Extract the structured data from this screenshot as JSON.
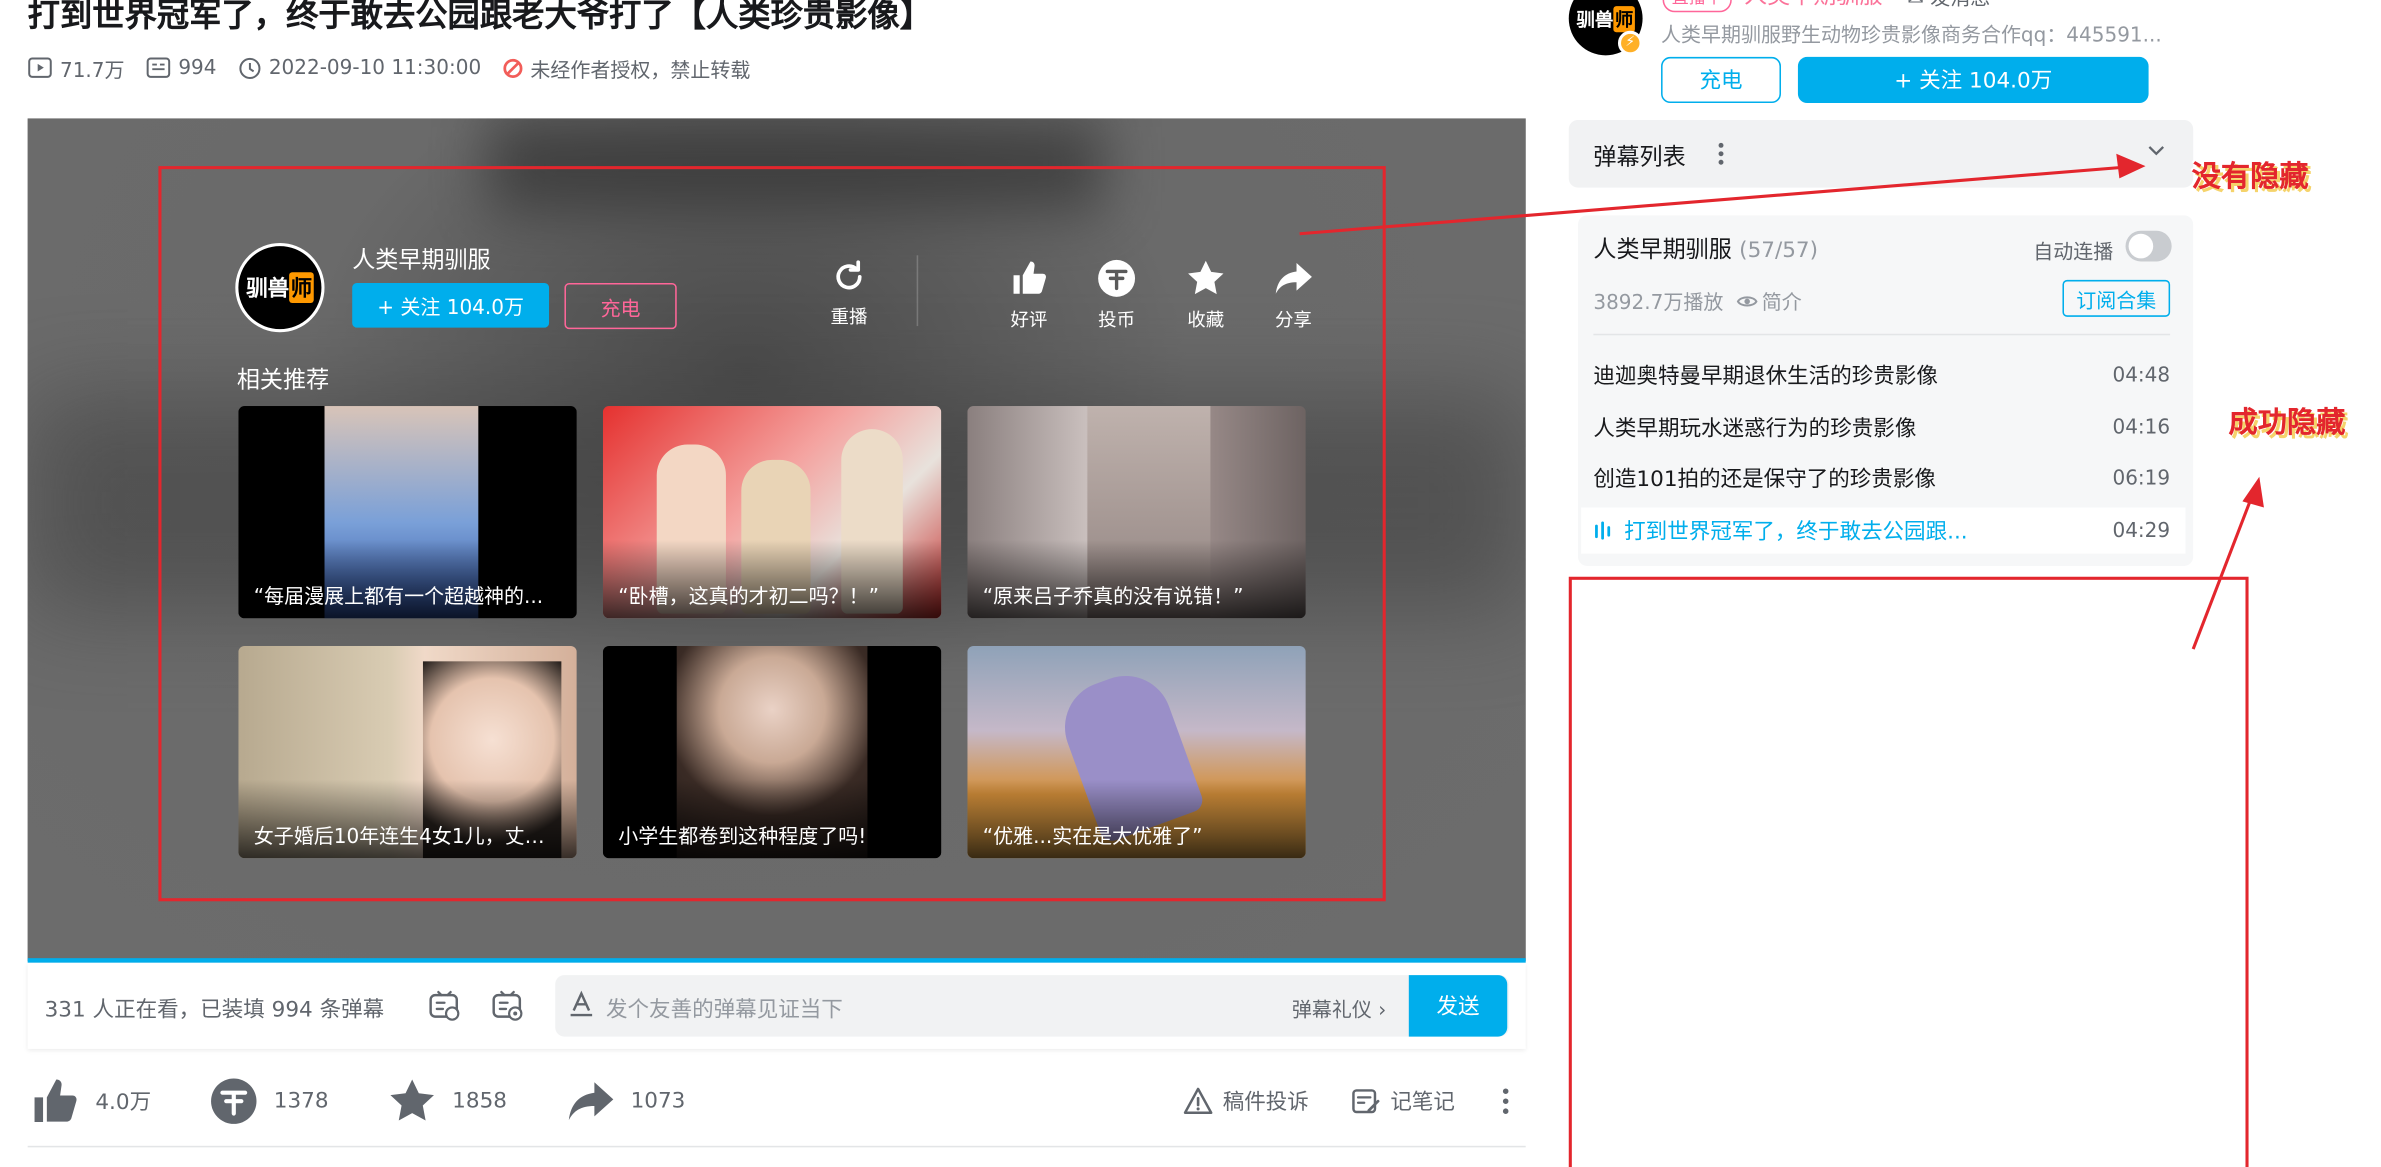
{
  "video": {
    "title": "打到世界冠军了，终于敢去公园跟老大爷打了【人类珍贵影像】",
    "views": "71.7万",
    "danmaku_count": "994",
    "datetime": "2022-09-10 11:30:00",
    "copyright_notice": "未经作者授权，禁止转载"
  },
  "player": {
    "uploader_name": "人类早期驯服",
    "avatar_text_a": "驯兽",
    "avatar_text_b": "师",
    "follow_label": "+ 关注 104.0万",
    "charge_label": "充电",
    "replay_label": "重播",
    "like_label": "好评",
    "coin_label": "投币",
    "fav_label": "收藏",
    "share_label": "分享",
    "related_label": "相关推荐",
    "related": [
      {
        "caption": "“每届漫展上都有一个超越神的..."
      },
      {
        "caption": "“卧槽，这真的才初二吗？！”"
      },
      {
        "caption": "“原来吕子乔真的没有说错！”"
      },
      {
        "caption": "女子婚后10年连生4女1儿，丈夫..."
      },
      {
        "caption": "小学生都卷到这种程度了吗!"
      },
      {
        "caption": "“优雅...实在是太优雅了”"
      }
    ]
  },
  "danmaku_bar": {
    "watching": "331 人正在看，已装填 994 条弹幕",
    "placeholder": "发个友善的弹幕见证当下",
    "etiquette": "弹幕礼仪 ›",
    "send_label": "发送"
  },
  "toolbar": {
    "like_count": "4.0万",
    "coin_count": "1378",
    "fav_count": "1858",
    "share_count": "1073",
    "report_label": "稿件投诉",
    "note_label": "记笔记"
  },
  "sidebar": {
    "avatar_text_a": "驯兽",
    "avatar_text_b": "师",
    "live_tag": "直播中",
    "uploader_name": "人类早期驯服",
    "message_label": "发消息",
    "description": "人类早期驯服野生动物珍贵影像商务合作qq：445591...",
    "charge_label": "充电",
    "follow_label": "+ 关注 104.0万",
    "danmaku_list_label": "弹幕列表",
    "collection": {
      "title": "人类早期驯服",
      "count": "(57/57)",
      "autoplay_label": "自动连播",
      "plays": "3892.7万播放",
      "intro_label": "简介",
      "subscribe_label": "订阅合集",
      "episodes": [
        {
          "title": "迪迦奥特曼早期退休生活的珍贵影像",
          "duration": "04:48"
        },
        {
          "title": "人类早期玩水迷惑行为的珍贵影像",
          "duration": "04:16"
        },
        {
          "title": "创造101拍的还是保守了的珍贵影像",
          "duration": "06:19"
        },
        {
          "title": "打到世界冠军了，终于敢去公园跟...",
          "duration": "04:29"
        }
      ]
    }
  },
  "annotations": {
    "not_hidden": "没有隐藏",
    "hidden_ok": "成功隐藏"
  },
  "colors": {
    "accent": "#00aeec",
    "pink": "#ff6699",
    "annotation_red": "#e3262d"
  }
}
